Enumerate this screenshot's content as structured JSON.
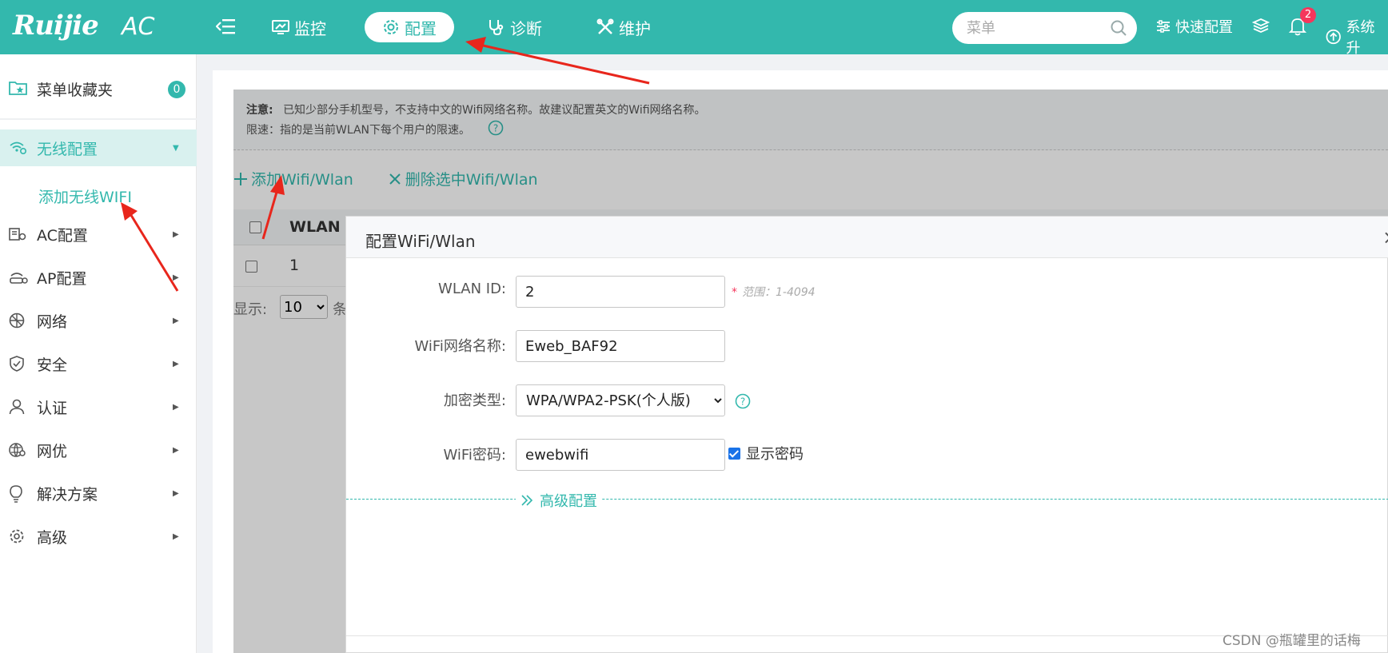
{
  "brand": {
    "logo": "Ruijie",
    "subtitle": "AC"
  },
  "topnav": {
    "items": [
      {
        "label": "监控",
        "icon": "monitor-icon"
      },
      {
        "label": "配置",
        "icon": "gear-icon"
      },
      {
        "label": "诊断",
        "icon": "stethoscope-icon"
      },
      {
        "label": "维护",
        "icon": "tools-icon"
      }
    ],
    "active": "配置",
    "search_placeholder": "菜单",
    "quick_config": "快速配置",
    "notification_count": "2",
    "system": "系统升"
  },
  "sidebar": {
    "favorites_label": "菜单收藏夹",
    "favorites_count": "0",
    "items": [
      {
        "label": "无线配置",
        "icon": "wifi-settings-icon"
      },
      {
        "label": "AC配置",
        "icon": "ac-icon"
      },
      {
        "label": "AP配置",
        "icon": "ap-icon"
      },
      {
        "label": "网络",
        "icon": "network-icon"
      },
      {
        "label": "安全",
        "icon": "shield-icon"
      },
      {
        "label": "认证",
        "icon": "user-icon"
      },
      {
        "label": "网优",
        "icon": "optimize-icon"
      },
      {
        "label": "解决方案",
        "icon": "bulb-icon"
      },
      {
        "label": "高级",
        "icon": "gear-icon"
      }
    ],
    "active_sub": "添加无线WIFI"
  },
  "content": {
    "notice_title": "注意:",
    "notice_text": "已知少部分手机型号，不支持中文的Wifi网络名称。故建议配置英文的Wifi网络名称。",
    "limit_text": "限速：指的是当前WLAN下每个用户的限速。",
    "add_button": "添加Wifi/Wlan",
    "delete_button": "删除选中Wifi/Wlan",
    "table_header": "WLAN I",
    "row_value": "1",
    "pager_label": "显示:",
    "pager_value": "10",
    "pager_suffix": "条"
  },
  "modal": {
    "title": "配置WiFi/Wlan",
    "close": "×",
    "wlan_id_label": "WLAN ID:",
    "wlan_id_value": "2",
    "wlan_id_hint": "范围：1-4094",
    "ssid_label": "WiFi网络名称:",
    "ssid_value": "Eweb_BAF92",
    "encryption_label": "加密类型:",
    "encryption_value": "WPA/WPA2-PSK(个人版)",
    "password_label": "WiFi密码:",
    "password_value": "ewebwifi",
    "show_password": "显示密码",
    "advanced": "高级配置"
  },
  "watermark": "CSDN @瓶罐里的话梅",
  "colors": {
    "primary": "#33b8ad",
    "badge": "#f5365c",
    "arrow": "#e8261c"
  }
}
